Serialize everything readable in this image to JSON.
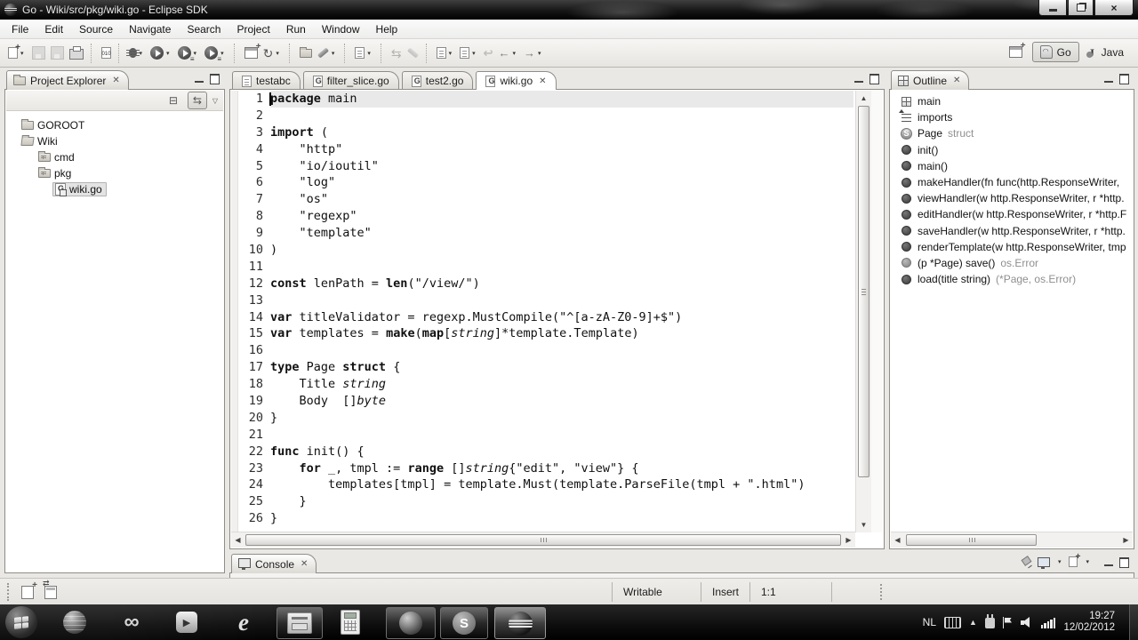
{
  "window": {
    "title": "Go - Wiki/src/pkg/wiki.go - Eclipse SDK"
  },
  "menu": {
    "items": [
      "File",
      "Edit",
      "Source",
      "Navigate",
      "Search",
      "Project",
      "Run",
      "Window",
      "Help"
    ]
  },
  "perspectives": {
    "go_label": "Go",
    "java_label": "Java"
  },
  "project_explorer": {
    "title": "Project Explorer",
    "tree": [
      {
        "label": "GOROOT",
        "icon": "folder",
        "indent": 0,
        "selected": false
      },
      {
        "label": "Wiki",
        "icon": "folder-open",
        "indent": 0,
        "selected": false
      },
      {
        "label": "cmd",
        "icon": "package-folder",
        "indent": 1,
        "selected": false
      },
      {
        "label": "pkg",
        "icon": "package-folder",
        "indent": 1,
        "selected": false
      },
      {
        "label": "wiki.go",
        "icon": "go-file",
        "indent": 2,
        "selected": true
      }
    ]
  },
  "editor": {
    "tabs": [
      {
        "label": "testabc",
        "icon": "text-file",
        "active": false
      },
      {
        "label": "filter_slice.go",
        "icon": "go-file",
        "active": false
      },
      {
        "label": "test2.go",
        "icon": "go-file",
        "active": false
      },
      {
        "label": "wiki.go",
        "icon": "go-file",
        "active": true
      }
    ],
    "lines": [
      [
        [
          "package",
          "k"
        ],
        [
          " main",
          ""
        ]
      ],
      [],
      [
        [
          "import",
          "k"
        ],
        [
          " (",
          ""
        ]
      ],
      [
        [
          "    \"http\"",
          ""
        ]
      ],
      [
        [
          "    \"io/ioutil\"",
          ""
        ]
      ],
      [
        [
          "    \"log\"",
          ""
        ]
      ],
      [
        [
          "    \"os\"",
          ""
        ]
      ],
      [
        [
          "    \"regexp\"",
          ""
        ]
      ],
      [
        [
          "    \"template\"",
          ""
        ]
      ],
      [
        [
          ")",
          ""
        ]
      ],
      [],
      [
        [
          "const",
          "k"
        ],
        [
          " lenPath = ",
          ""
        ],
        [
          "len",
          "k"
        ],
        [
          "(\"/view/\")",
          ""
        ]
      ],
      [],
      [
        [
          "var",
          "k"
        ],
        [
          " titleValidator = regexp.MustCompile(\"^[a-zA-Z0-9]+$\")",
          ""
        ]
      ],
      [
        [
          "var",
          "k"
        ],
        [
          " templates = ",
          ""
        ],
        [
          "make",
          "k"
        ],
        [
          "(",
          ""
        ],
        [
          "map",
          "k"
        ],
        [
          "[",
          ""
        ],
        [
          "string",
          "i"
        ],
        [
          "]*template.Template)",
          ""
        ]
      ],
      [],
      [
        [
          "type",
          "k"
        ],
        [
          " Page ",
          ""
        ],
        [
          "struct",
          "k"
        ],
        [
          " {",
          ""
        ]
      ],
      [
        [
          "    Title ",
          ""
        ],
        [
          "string",
          "i"
        ]
      ],
      [
        [
          "    Body  []",
          ""
        ],
        [
          "byte",
          "i"
        ]
      ],
      [
        [
          "}",
          ""
        ]
      ],
      [],
      [
        [
          "func",
          "k"
        ],
        [
          " init() {",
          ""
        ]
      ],
      [
        [
          "    ",
          ""
        ],
        [
          "for",
          "k"
        ],
        [
          " _, tmpl := ",
          ""
        ],
        [
          "range",
          "k"
        ],
        [
          " []",
          ""
        ],
        [
          "string",
          "i"
        ],
        [
          "{\"edit\", \"view\"} {",
          ""
        ]
      ],
      [
        [
          "        templates[tmpl] = template.Must(template.ParseFile(tmpl + \".html\")",
          ""
        ]
      ],
      [
        [
          "    }",
          ""
        ]
      ],
      [
        [
          "}",
          ""
        ]
      ]
    ]
  },
  "outline": {
    "title": "Outline",
    "items": [
      {
        "icon": "package",
        "label": "main",
        "detail": ""
      },
      {
        "icon": "imports",
        "label": "imports",
        "detail": ""
      },
      {
        "icon": "struct",
        "label": "Page",
        "detail": "struct"
      },
      {
        "icon": "func",
        "label": "init()",
        "detail": ""
      },
      {
        "icon": "func",
        "label": "main()",
        "detail": ""
      },
      {
        "icon": "func",
        "label": "makeHandler(fn func(http.ResponseWriter,",
        "detail": ""
      },
      {
        "icon": "func",
        "label": "viewHandler(w http.ResponseWriter, r *http.",
        "detail": ""
      },
      {
        "icon": "func",
        "label": "editHandler(w http.ResponseWriter, r *http.F",
        "detail": ""
      },
      {
        "icon": "func",
        "label": "saveHandler(w http.ResponseWriter, r *http.",
        "detail": ""
      },
      {
        "icon": "func",
        "label": "renderTemplate(w http.ResponseWriter, tmp",
        "detail": ""
      },
      {
        "icon": "method-light",
        "label": "(p *Page) save()",
        "detail": "os.Error"
      },
      {
        "icon": "func",
        "label": "load(title string)",
        "detail": "(*Page, os.Error)"
      }
    ]
  },
  "console": {
    "title": "Console"
  },
  "statusbar": {
    "writable": "Writable",
    "insert": "Insert",
    "position": "1:1"
  },
  "taskbar": {
    "language": "NL",
    "time": "19:27",
    "date": "12/02/2012"
  }
}
